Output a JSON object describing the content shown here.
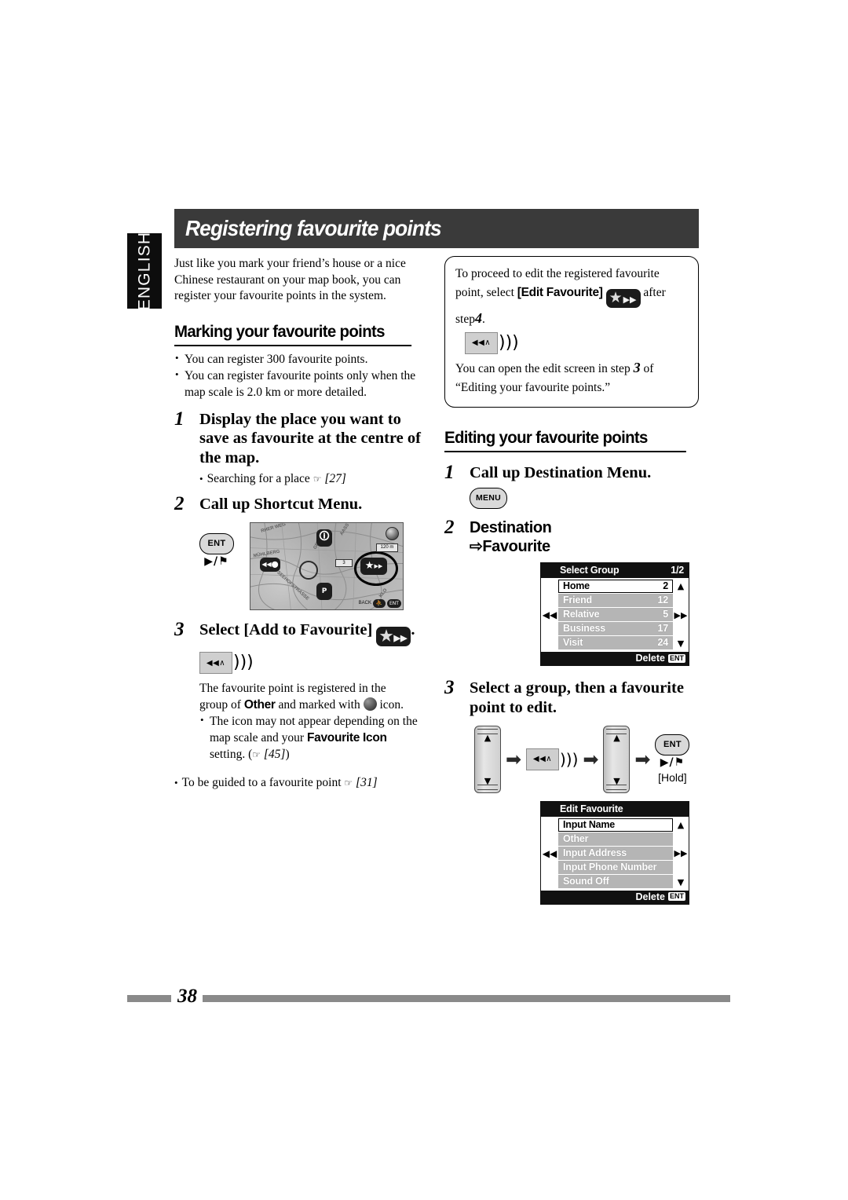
{
  "page": {
    "language_tab": "ENGLISH",
    "title": "Registering favourite points",
    "page_number": "38"
  },
  "intro": {
    "paragraph": "Just like you mark your friend’s house or a nice Chinese restaurant on your map book, you can register your favourite points in the system."
  },
  "marking": {
    "heading": "Marking your favourite points",
    "bullets": [
      "You can register 300 favourite points.",
      "You can register favourite points only when the map scale is 2.0 km or more detailed."
    ],
    "step1": {
      "num": "1",
      "text": "Display the place you want to save as favourite at the centre of the map.",
      "note": "Searching for a place",
      "note_ref": "[27]"
    },
    "step2": {
      "num": "2",
      "text": "Call up Shortcut Menu.",
      "button_label": "ENT",
      "button_sub": "▶/⚑"
    },
    "step3": {
      "num": "3",
      "text_before": "Select [Add to Favourite]",
      "text_after": ".",
      "key_label": "◀◀∧",
      "result_line_a": "The favourite point is registered in the",
      "result_line_b_pre": "group of",
      "result_bold": "Other",
      "result_line_b_post": "and marked with",
      "result_line_b_end": "icon.",
      "sub_bullet_pre": "The icon may not appear depending on the map scale and your",
      "sub_bullet_bold": "Favourite Icon",
      "sub_bullet_post": "setting. (",
      "sub_bullet_ref": "[45]",
      "sub_bullet_close": ")"
    },
    "trailing_bullet": "To be guided to a favourite point",
    "trailing_ref": "[31]"
  },
  "map_shot": {
    "street_labels": [
      "RHER WEG",
      "MÜHLBERG",
      "GELBER",
      "AASS",
      "SEEHOFSTRASSE"
    ],
    "scale_label": "120 m",
    "zoom_level": "3",
    "bottom_left_label": "BACK",
    "bottom_right_label": "ENT"
  },
  "note_box": {
    "line1": "To proceed to edit the registered favourite",
    "line2_pre": "point, select",
    "line2_bold": "[Edit Favourite]",
    "line2_post": "after",
    "line3_pre": "step",
    "line3_num": "4",
    "line3_post": ".",
    "key_label": "◀◀∧",
    "line4_pre": "You can open the edit screen in step",
    "line4_num": "3",
    "line4_post": "of",
    "line5": "“Editing your favourite points.”"
  },
  "editing": {
    "heading": "Editing your favourite points",
    "step1": {
      "num": "1",
      "text": "Call up Destination Menu.",
      "button_label": "MENU"
    },
    "step2": {
      "num": "2",
      "line1": "Destination",
      "arrow": "⇨",
      "line2": "Favourite"
    },
    "step3": {
      "num": "3",
      "text": "Select a group, then a favourite point to edit.",
      "key_label": "◀◀∧",
      "ent_label": "ENT",
      "ent_sub": "▶/⚑",
      "hold_label": "[Hold]"
    }
  },
  "lcd_select_group": {
    "title": "Select Group",
    "page_indicator": "1/2",
    "prev_icon": "◀◀",
    "next_icon": "▶▶",
    "up_icon": "▲",
    "down_icon": "▼",
    "rows": [
      {
        "label": "Home",
        "value": "2",
        "selected": true
      },
      {
        "label": "Friend",
        "value": "12",
        "selected": false
      },
      {
        "label": "Relative",
        "value": "5",
        "selected": false
      },
      {
        "label": "Business",
        "value": "17",
        "selected": false
      },
      {
        "label": "Visit",
        "value": "24",
        "selected": false
      }
    ],
    "footer_label": "Delete",
    "footer_chip": "ENT"
  },
  "lcd_edit_favourite": {
    "title": "Edit Favourite",
    "page_indicator": "",
    "prev_icon": "◀◀",
    "next_icon": "▶▶",
    "up_icon": "▲",
    "down_icon": "▼",
    "rows": [
      {
        "label": "Input Name",
        "value": "",
        "selected": true
      },
      {
        "label": "Other",
        "value": "",
        "selected": false
      },
      {
        "label": "Input Address",
        "value": "",
        "selected": false
      },
      {
        "label": "Input Phone Number",
        "value": "",
        "selected": false
      },
      {
        "label": "Sound Off",
        "value": "",
        "selected": false
      }
    ],
    "footer_label": "Delete",
    "footer_chip": "ENT"
  },
  "colors": {
    "title_bar": "#3a3a3a",
    "tab": "#0d0d0d",
    "lcd_row": "#b5b5b5",
    "footer_rule": "#8a8a8a"
  }
}
